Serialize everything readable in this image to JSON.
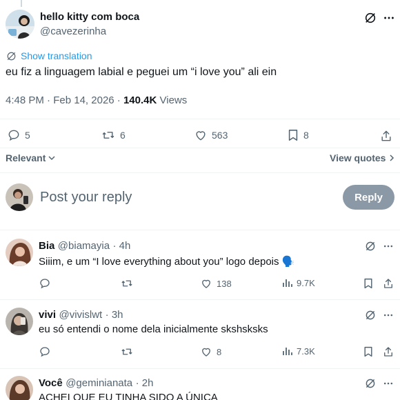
{
  "main_post": {
    "display_name": "hello kitty com boca",
    "handle": "@cavezerinha",
    "translate_label": "Show translation",
    "text": "eu fiz a linguagem labial e peguei um “i love you” ali ein",
    "time": "4:48 PM",
    "date": "Feb 14, 2026",
    "views_count": "140.4K",
    "views_label": "Views",
    "replies": "5",
    "reposts": "6",
    "likes": "563",
    "bookmarks": "8"
  },
  "sort": {
    "relevant_label": "Relevant",
    "view_quotes_label": "View quotes"
  },
  "composer": {
    "placeholder": "Post your reply",
    "reply_button": "Reply"
  },
  "replies": [
    {
      "display_name": "Bia",
      "handle": "@biamayia",
      "age": "· 4h",
      "text": "Siiim, e um “I love everything about you” logo depois 🗣️",
      "replies": "",
      "reposts": "",
      "likes": "138",
      "views": "9.7K"
    },
    {
      "display_name": "vivi",
      "handle": "@vivislwt",
      "age": "· 3h",
      "text": "eu só entendi o nome dela inicialmente skshsksks",
      "replies": "",
      "reposts": "",
      "likes": "8",
      "views": "7.3K"
    },
    {
      "display_name": "Você",
      "handle": "@geminianata",
      "age": "· 2h",
      "text": "ACHEI QUE EU TINHA SIDO A ÚNICA"
    }
  ],
  "colors": {
    "accent": "#1d9bf0",
    "text": "#0f1419",
    "muted": "#536471",
    "divider": "#eff3f4",
    "reply_button_bg": "#8b98a5"
  }
}
